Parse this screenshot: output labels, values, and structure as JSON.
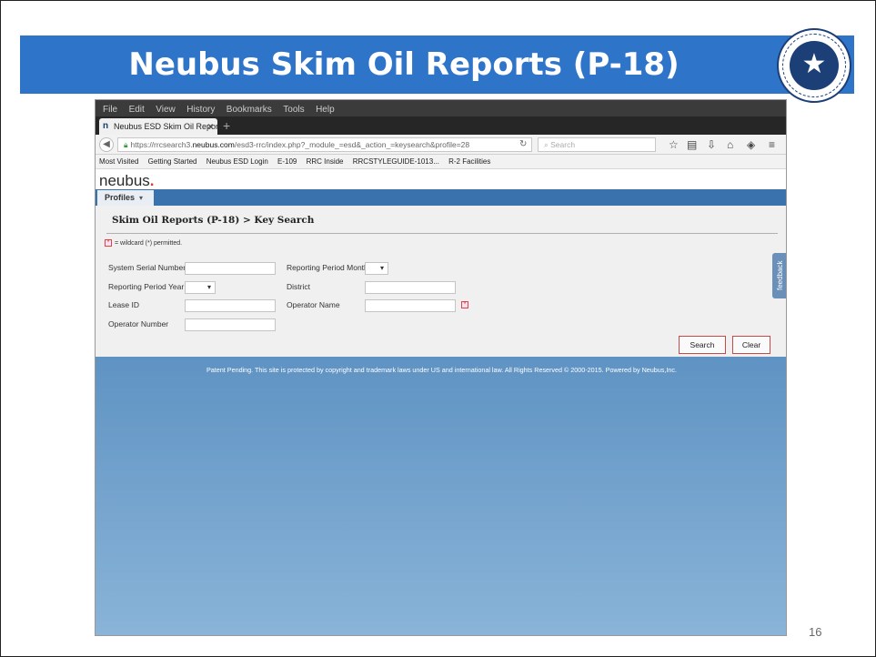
{
  "slide": {
    "title": "Neubus Skim Oil Reports (P-18)",
    "page_number": "16",
    "seal_icon": "texas-star-seal-icon",
    "colors": {
      "title_bar": "#2e74c8",
      "site_bar": "#3a72ae",
      "footer_gradient_top": "#5f93c3",
      "button_border": "#c94848"
    }
  },
  "browser": {
    "menu": [
      "File",
      "Edit",
      "View",
      "History",
      "Bookmarks",
      "Tools",
      "Help"
    ],
    "tab_title": "Neubus ESD Skim Oil Reports",
    "url_prefix": "https://rrcsearch3.",
    "url_domain": "neubus.com",
    "url_path": "/esd3-rrc/index.php?_module_=esd&_action_=keysearch&profile=28",
    "search_placeholder": "Search",
    "bookmarks": [
      "Most Visited",
      "Getting Started",
      "Neubus ESD Login",
      "E-109",
      "RRC Inside",
      "RRCSTYLEGUIDE-1013...",
      "R-2 Facilities"
    ]
  },
  "site": {
    "logo": "neubus",
    "nav": {
      "profiles_label": "Profiles"
    },
    "heading": "Skim Oil Reports (P-18) > Key Search",
    "wildcard_note": "= wildcard (*) permitted.",
    "fields": {
      "system_serial_number": "System Serial Number",
      "reporting_period_month": "Reporting Period Month",
      "reporting_period_year": "Reporting Period Year",
      "district": "District",
      "lease_id": "Lease ID",
      "operator_name": "Operator Name",
      "operator_number": "Operator Number"
    },
    "buttons": {
      "search": "Search",
      "clear": "Clear"
    },
    "feedback": "feedback",
    "footer": "Patent Pending. This site is protected by copyright and trademark laws under US and international law. All Rights Reserved © 2000-2015. Powered by Neubus,Inc."
  }
}
